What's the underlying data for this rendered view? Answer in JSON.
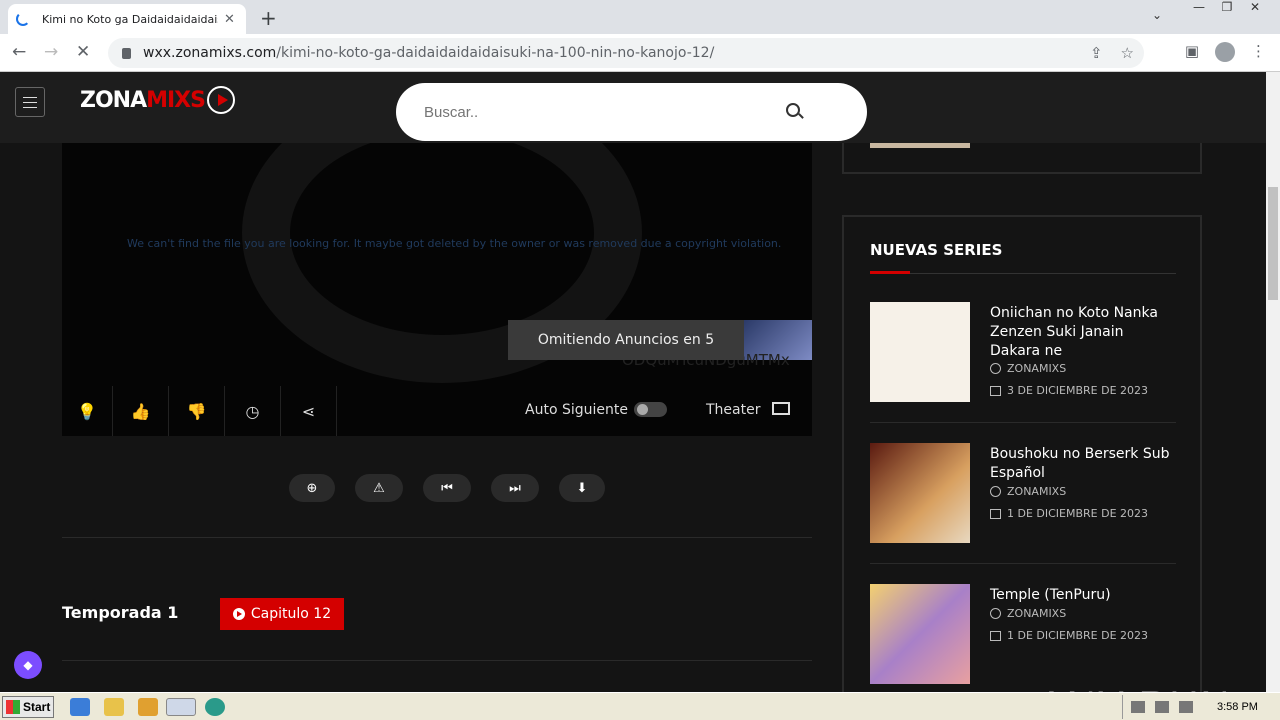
{
  "browser": {
    "tab_title": "Kimi no Koto ga Daidaidaidaidaisuki na",
    "url_host": "wxx.zonamixs.com",
    "url_path": "/kimi-no-koto-ga-daidaidaidaidaisuki-na-100-nin-no-kanojo-12/"
  },
  "site": {
    "logo_zona": "ZONA",
    "logo_mixs": "MIXS",
    "search_placeholder": "Buscar.."
  },
  "player": {
    "error_text": "We can't find the file you are looking for. It maybe got deleted by the owner or was removed due a copyright violation.",
    "skip_text": "Omitiendo Anuncios en  5",
    "code_text": "ODQuMTcuNDguMTMx",
    "auto_next_label": "Auto Siguiente",
    "theater_label": "Theater"
  },
  "episodes": {
    "season_label": "Temporada 1",
    "chapter_label": "Capitulo  12"
  },
  "sidebar": {
    "heading": "NUEVAS SERIES",
    "items": [
      {
        "title": "Oniichan no Koto Nanka Zenzen Suki Janain Dakara ne",
        "author": "ZONAMIXS",
        "date": "3 DE DICIEMBRE DE 2023"
      },
      {
        "title": "Boushoku no Berserk Sub Español",
        "author": "ZONAMIXS",
        "date": "1 DE DICIEMBRE DE 2023"
      },
      {
        "title": "Temple (TenPuru)",
        "author": "ZONAMIXS",
        "date": "1 DE DICIEMBRE DE 2023"
      }
    ]
  },
  "watermark": "ANY RUN",
  "taskbar": {
    "start_label": "Start",
    "clock": "3:58 PM"
  }
}
